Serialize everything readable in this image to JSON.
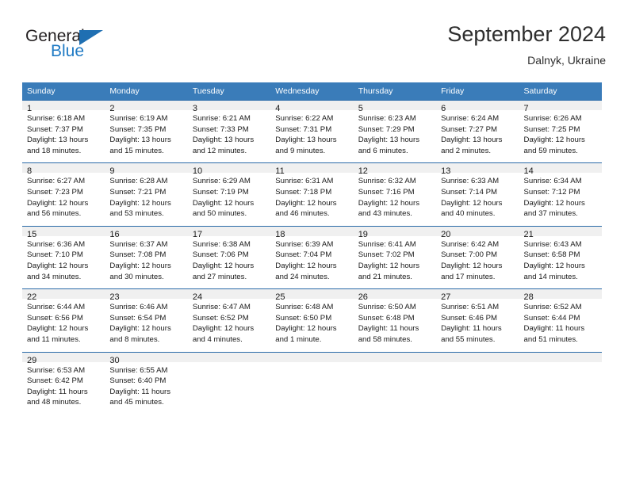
{
  "brand": {
    "name_part1": "General",
    "name_part2": "Blue",
    "triangle_color": "#1f6fb2",
    "blue_color": "#1f7ac4"
  },
  "header": {
    "title": "September 2024",
    "subtitle": "Dalnyk, Ukraine"
  },
  "theme": {
    "header_blue": "#3a7cb9",
    "row_line_blue": "#2a6ba8",
    "daynum_gray": "#f0f0f0"
  },
  "weekday_headers": [
    "Sunday",
    "Monday",
    "Tuesday",
    "Wednesday",
    "Thursday",
    "Friday",
    "Saturday"
  ],
  "weeks": [
    [
      {
        "day": "1",
        "sunrise": "Sunrise: 6:18 AM",
        "sunset": "Sunset: 7:37 PM",
        "daylight_line1": "Daylight: 13 hours",
        "daylight_line2": "and 18 minutes."
      },
      {
        "day": "2",
        "sunrise": "Sunrise: 6:19 AM",
        "sunset": "Sunset: 7:35 PM",
        "daylight_line1": "Daylight: 13 hours",
        "daylight_line2": "and 15 minutes."
      },
      {
        "day": "3",
        "sunrise": "Sunrise: 6:21 AM",
        "sunset": "Sunset: 7:33 PM",
        "daylight_line1": "Daylight: 13 hours",
        "daylight_line2": "and 12 minutes."
      },
      {
        "day": "4",
        "sunrise": "Sunrise: 6:22 AM",
        "sunset": "Sunset: 7:31 PM",
        "daylight_line1": "Daylight: 13 hours",
        "daylight_line2": "and 9 minutes."
      },
      {
        "day": "5",
        "sunrise": "Sunrise: 6:23 AM",
        "sunset": "Sunset: 7:29 PM",
        "daylight_line1": "Daylight: 13 hours",
        "daylight_line2": "and 6 minutes."
      },
      {
        "day": "6",
        "sunrise": "Sunrise: 6:24 AM",
        "sunset": "Sunset: 7:27 PM",
        "daylight_line1": "Daylight: 13 hours",
        "daylight_line2": "and 2 minutes."
      },
      {
        "day": "7",
        "sunrise": "Sunrise: 6:26 AM",
        "sunset": "Sunset: 7:25 PM",
        "daylight_line1": "Daylight: 12 hours",
        "daylight_line2": "and 59 minutes."
      }
    ],
    [
      {
        "day": "8",
        "sunrise": "Sunrise: 6:27 AM",
        "sunset": "Sunset: 7:23 PM",
        "daylight_line1": "Daylight: 12 hours",
        "daylight_line2": "and 56 minutes."
      },
      {
        "day": "9",
        "sunrise": "Sunrise: 6:28 AM",
        "sunset": "Sunset: 7:21 PM",
        "daylight_line1": "Daylight: 12 hours",
        "daylight_line2": "and 53 minutes."
      },
      {
        "day": "10",
        "sunrise": "Sunrise: 6:29 AM",
        "sunset": "Sunset: 7:19 PM",
        "daylight_line1": "Daylight: 12 hours",
        "daylight_line2": "and 50 minutes."
      },
      {
        "day": "11",
        "sunrise": "Sunrise: 6:31 AM",
        "sunset": "Sunset: 7:18 PM",
        "daylight_line1": "Daylight: 12 hours",
        "daylight_line2": "and 46 minutes."
      },
      {
        "day": "12",
        "sunrise": "Sunrise: 6:32 AM",
        "sunset": "Sunset: 7:16 PM",
        "daylight_line1": "Daylight: 12 hours",
        "daylight_line2": "and 43 minutes."
      },
      {
        "day": "13",
        "sunrise": "Sunrise: 6:33 AM",
        "sunset": "Sunset: 7:14 PM",
        "daylight_line1": "Daylight: 12 hours",
        "daylight_line2": "and 40 minutes."
      },
      {
        "day": "14",
        "sunrise": "Sunrise: 6:34 AM",
        "sunset": "Sunset: 7:12 PM",
        "daylight_line1": "Daylight: 12 hours",
        "daylight_line2": "and 37 minutes."
      }
    ],
    [
      {
        "day": "15",
        "sunrise": "Sunrise: 6:36 AM",
        "sunset": "Sunset: 7:10 PM",
        "daylight_line1": "Daylight: 12 hours",
        "daylight_line2": "and 34 minutes."
      },
      {
        "day": "16",
        "sunrise": "Sunrise: 6:37 AM",
        "sunset": "Sunset: 7:08 PM",
        "daylight_line1": "Daylight: 12 hours",
        "daylight_line2": "and 30 minutes."
      },
      {
        "day": "17",
        "sunrise": "Sunrise: 6:38 AM",
        "sunset": "Sunset: 7:06 PM",
        "daylight_line1": "Daylight: 12 hours",
        "daylight_line2": "and 27 minutes."
      },
      {
        "day": "18",
        "sunrise": "Sunrise: 6:39 AM",
        "sunset": "Sunset: 7:04 PM",
        "daylight_line1": "Daylight: 12 hours",
        "daylight_line2": "and 24 minutes."
      },
      {
        "day": "19",
        "sunrise": "Sunrise: 6:41 AM",
        "sunset": "Sunset: 7:02 PM",
        "daylight_line1": "Daylight: 12 hours",
        "daylight_line2": "and 21 minutes."
      },
      {
        "day": "20",
        "sunrise": "Sunrise: 6:42 AM",
        "sunset": "Sunset: 7:00 PM",
        "daylight_line1": "Daylight: 12 hours",
        "daylight_line2": "and 17 minutes."
      },
      {
        "day": "21",
        "sunrise": "Sunrise: 6:43 AM",
        "sunset": "Sunset: 6:58 PM",
        "daylight_line1": "Daylight: 12 hours",
        "daylight_line2": "and 14 minutes."
      }
    ],
    [
      {
        "day": "22",
        "sunrise": "Sunrise: 6:44 AM",
        "sunset": "Sunset: 6:56 PM",
        "daylight_line1": "Daylight: 12 hours",
        "daylight_line2": "and 11 minutes."
      },
      {
        "day": "23",
        "sunrise": "Sunrise: 6:46 AM",
        "sunset": "Sunset: 6:54 PM",
        "daylight_line1": "Daylight: 12 hours",
        "daylight_line2": "and 8 minutes."
      },
      {
        "day": "24",
        "sunrise": "Sunrise: 6:47 AM",
        "sunset": "Sunset: 6:52 PM",
        "daylight_line1": "Daylight: 12 hours",
        "daylight_line2": "and 4 minutes."
      },
      {
        "day": "25",
        "sunrise": "Sunrise: 6:48 AM",
        "sunset": "Sunset: 6:50 PM",
        "daylight_line1": "Daylight: 12 hours",
        "daylight_line2": "and 1 minute."
      },
      {
        "day": "26",
        "sunrise": "Sunrise: 6:50 AM",
        "sunset": "Sunset: 6:48 PM",
        "daylight_line1": "Daylight: 11 hours",
        "daylight_line2": "and 58 minutes."
      },
      {
        "day": "27",
        "sunrise": "Sunrise: 6:51 AM",
        "sunset": "Sunset: 6:46 PM",
        "daylight_line1": "Daylight: 11 hours",
        "daylight_line2": "and 55 minutes."
      },
      {
        "day": "28",
        "sunrise": "Sunrise: 6:52 AM",
        "sunset": "Sunset: 6:44 PM",
        "daylight_line1": "Daylight: 11 hours",
        "daylight_line2": "and 51 minutes."
      }
    ],
    [
      {
        "day": "29",
        "sunrise": "Sunrise: 6:53 AM",
        "sunset": "Sunset: 6:42 PM",
        "daylight_line1": "Daylight: 11 hours",
        "daylight_line2": "and 48 minutes."
      },
      {
        "day": "30",
        "sunrise": "Sunrise: 6:55 AM",
        "sunset": "Sunset: 6:40 PM",
        "daylight_line1": "Daylight: 11 hours",
        "daylight_line2": "and 45 minutes."
      },
      {
        "day": "",
        "sunrise": "",
        "sunset": "",
        "daylight_line1": "",
        "daylight_line2": ""
      },
      {
        "day": "",
        "sunrise": "",
        "sunset": "",
        "daylight_line1": "",
        "daylight_line2": ""
      },
      {
        "day": "",
        "sunrise": "",
        "sunset": "",
        "daylight_line1": "",
        "daylight_line2": ""
      },
      {
        "day": "",
        "sunrise": "",
        "sunset": "",
        "daylight_line1": "",
        "daylight_line2": ""
      },
      {
        "day": "",
        "sunrise": "",
        "sunset": "",
        "daylight_line1": "",
        "daylight_line2": ""
      }
    ]
  ]
}
